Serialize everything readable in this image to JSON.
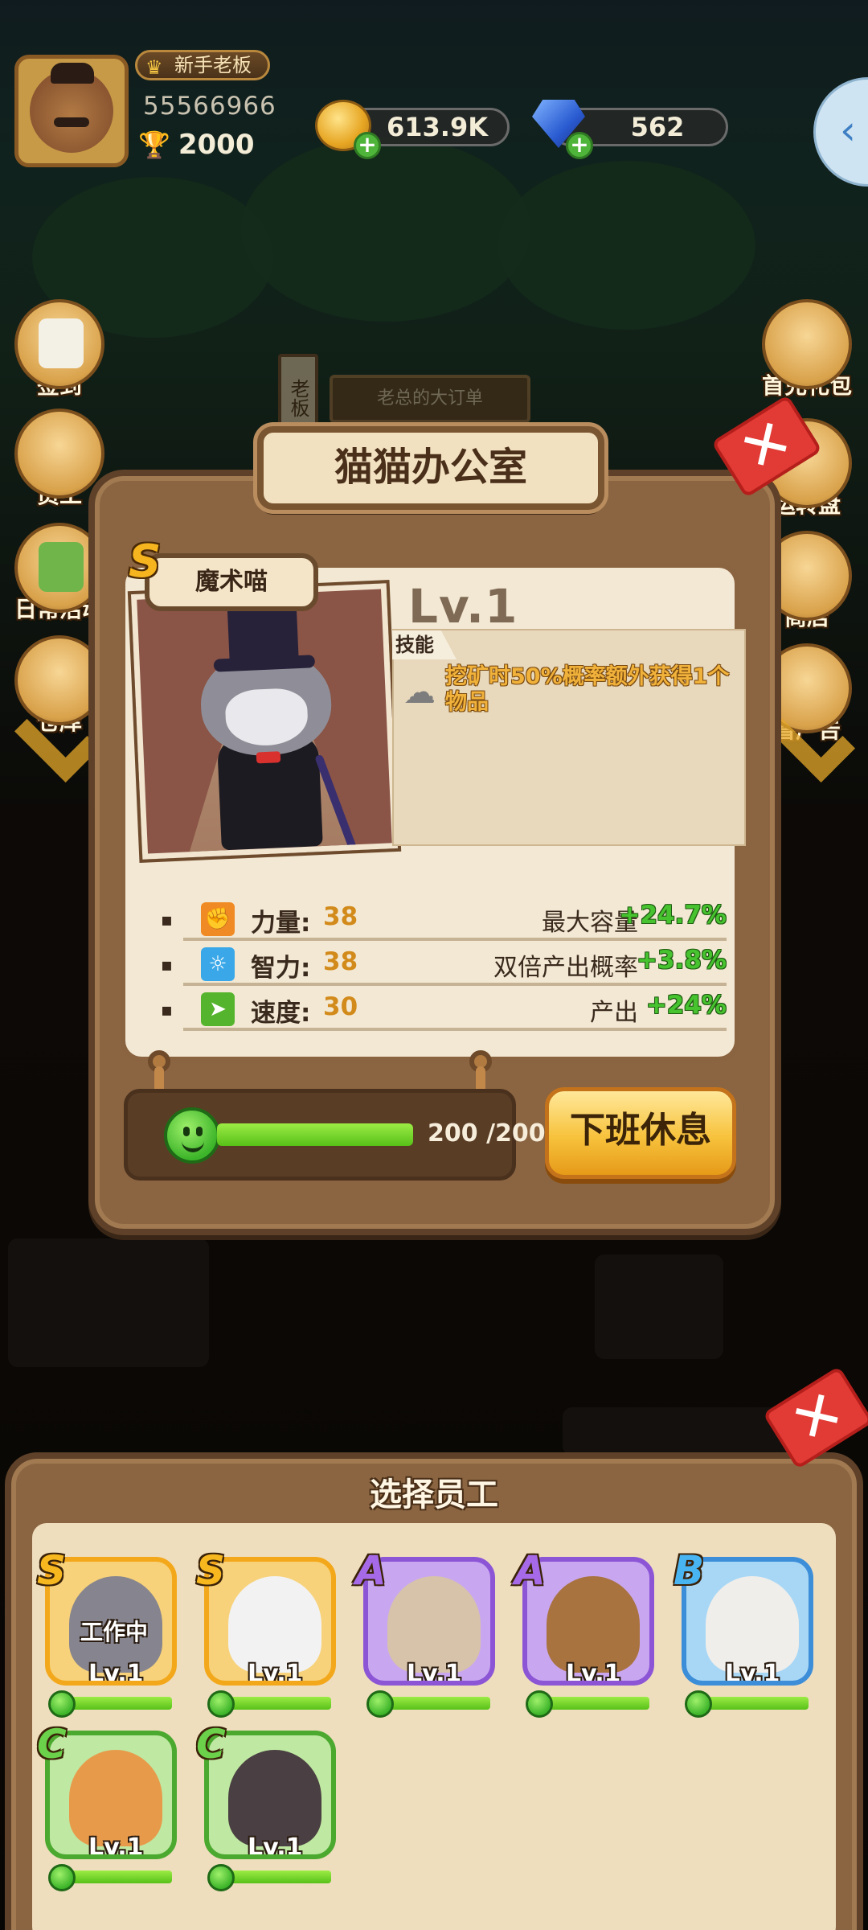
{
  "hud": {
    "title_badge": "新手老板",
    "player_id": "55566966",
    "trophies": "2000",
    "coins": "613.9K",
    "gems": "562",
    "toggle_glyph": "‹"
  },
  "side_menu_left": [
    {
      "label": "签到",
      "icon": "calendar-icon"
    },
    {
      "label": "员工",
      "icon": "staff-icon"
    },
    {
      "label": "日常活动",
      "icon": "daily-activity-icon"
    },
    {
      "label": "仓库",
      "icon": "warehouse-icon"
    }
  ],
  "side_menu_right": [
    {
      "label": "首充礼包",
      "icon": "first-recharge-gift-icon"
    },
    {
      "label": "运转盘",
      "icon": "lucky-wheel-icon"
    },
    {
      "label": "商店",
      "icon": "shop-icon"
    },
    {
      "label": "看广告",
      "icon": "watch-ad-icon"
    }
  ],
  "background": {
    "sign_text": "老总的大订单",
    "vertical_sign": "老板"
  },
  "office": {
    "title": "猫猫办公室",
    "close_glyph": "✕",
    "character": {
      "name": "魔术喵",
      "rarity": "S",
      "level": "Lv.1",
      "skill_tag": "技能",
      "skill_desc": "挖矿时50%概率额外获得1个物品"
    },
    "stats": [
      {
        "icon": "strength-icon",
        "icon_color": "#f08a24",
        "glyph": "💪",
        "label": "力量:",
        "value": "38",
        "bonus_label": "最大容量",
        "bonus_value": "+24.7%"
      },
      {
        "icon": "intellect-icon",
        "icon_color": "#3aa8e8",
        "glyph": "💡",
        "label": "智力:",
        "value": "38",
        "bonus_label": "双倍产出概率",
        "bonus_value": "+3.8%"
      },
      {
        "icon": "speed-icon",
        "icon_color": "#55b42d",
        "glyph": "🏃",
        "label": "速度:",
        "value": "30",
        "bonus_label": "产出",
        "bonus_value": "+24%"
      }
    ],
    "stamina": {
      "current": 200,
      "max": 200,
      "text": "200 /200"
    },
    "offwork_button": "下班休息"
  },
  "staff_panel": {
    "title": "选择员工",
    "close_glyph": "✕",
    "staff": [
      {
        "rarity": "S",
        "rarity_color": "#f7b81f",
        "frame_color": "#f3a81c",
        "bg": "#f7d27a",
        "pic": "#86848e",
        "level": "Lv.1",
        "status": "工作中",
        "stamina": 1.0
      },
      {
        "rarity": "S",
        "rarity_color": "#f7b81f",
        "frame_color": "#f3a81c",
        "bg": "#f7d27a",
        "pic": "#f2f2f2",
        "level": "Lv.1",
        "status": "",
        "stamina": 1.0
      },
      {
        "rarity": "A",
        "rarity_color": "#a66ae8",
        "frame_color": "#8c55d6",
        "bg": "#c9a7f0",
        "pic": "#d7c2aa",
        "level": "Lv.1",
        "status": "",
        "stamina": 1.0
      },
      {
        "rarity": "A",
        "rarity_color": "#a66ae8",
        "frame_color": "#8c55d6",
        "bg": "#c9a7f0",
        "pic": "#a8733f",
        "level": "Lv.1",
        "status": "",
        "stamina": 1.0
      },
      {
        "rarity": "B",
        "rarity_color": "#49b4f2",
        "frame_color": "#3c8ed8",
        "bg": "#a8d7f6",
        "pic": "#f0eeea",
        "level": "Lv.1",
        "status": "",
        "stamina": 1.0
      },
      {
        "rarity": "C",
        "rarity_color": "#6bd04a",
        "frame_color": "#4aa92e",
        "bg": "#bfe8a2",
        "pic": "#e89a4b",
        "level": "Lv.1",
        "status": "",
        "stamina": 1.0
      },
      {
        "rarity": "C",
        "rarity_color": "#6bd04a",
        "frame_color": "#4aa92e",
        "bg": "#bfe8a2",
        "pic": "#4a3f42",
        "level": "Lv.1",
        "status": "",
        "stamina": 1.0
      }
    ]
  }
}
